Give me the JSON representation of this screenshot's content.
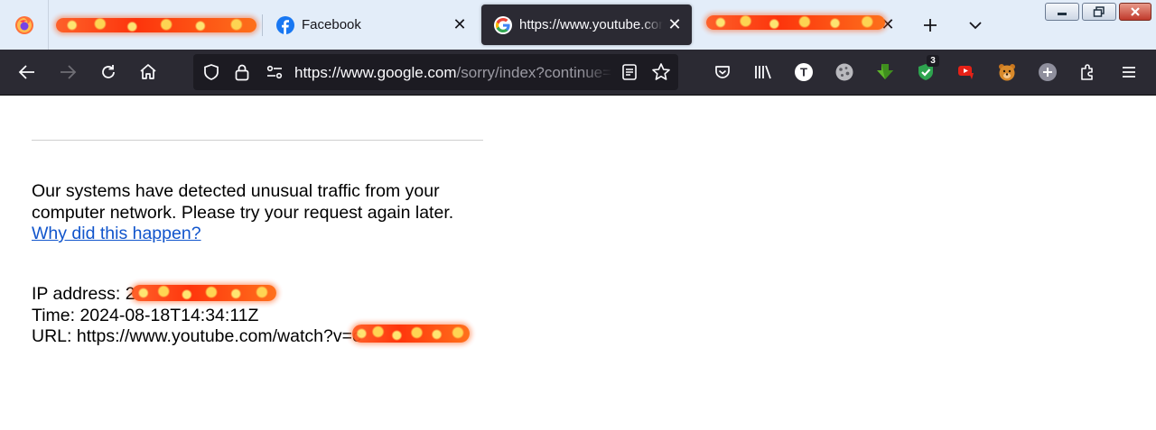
{
  "browser": {
    "tabs": [
      {
        "title": "",
        "redacted": true,
        "favicon": "redacted-icon",
        "active": false
      },
      {
        "title": "Facebook",
        "favicon": "facebook-icon",
        "active": false
      },
      {
        "title": "https://www.youtube.com/watch?v=",
        "favicon": "google-icon",
        "active": true
      },
      {
        "title": "",
        "redacted": true,
        "favicon": "redacted-icon",
        "active": false
      }
    ],
    "url": {
      "host": "https://www.google.com",
      "path": "/sorry/index?continue=https://www.youtube.com/watch"
    },
    "extensions": [
      {
        "name": "pocket-icon"
      },
      {
        "name": "library-icon"
      },
      {
        "name": "t-extension-icon",
        "label": "T"
      },
      {
        "name": "cookie-icon"
      },
      {
        "name": "download-arrow-icon"
      },
      {
        "name": "shield-check-icon",
        "badge": "3"
      },
      {
        "name": "youtube-dislike-icon"
      },
      {
        "name": "bear-icon"
      },
      {
        "name": "plus-circle-icon"
      },
      {
        "name": "extensions-puzzle-icon"
      },
      {
        "name": "hamburger-menu-icon"
      }
    ],
    "colors": {
      "tabstrip_bg": "#e3edf9",
      "toolbar_bg": "#2b2a33",
      "urlbar_bg": "#1c1b22",
      "link": "#1155cc"
    }
  },
  "page": {
    "message_line1": "Our systems have detected unusual traffic from your",
    "message_line2": "computer network. Please try your request again later.",
    "why_link": "Why did this happen?",
    "ip_label": "IP address: 2",
    "time_label": "Time: 2024-08-18T14:34:11Z",
    "url_label": "URL: https://www.youtube.com/watch?v=c"
  }
}
